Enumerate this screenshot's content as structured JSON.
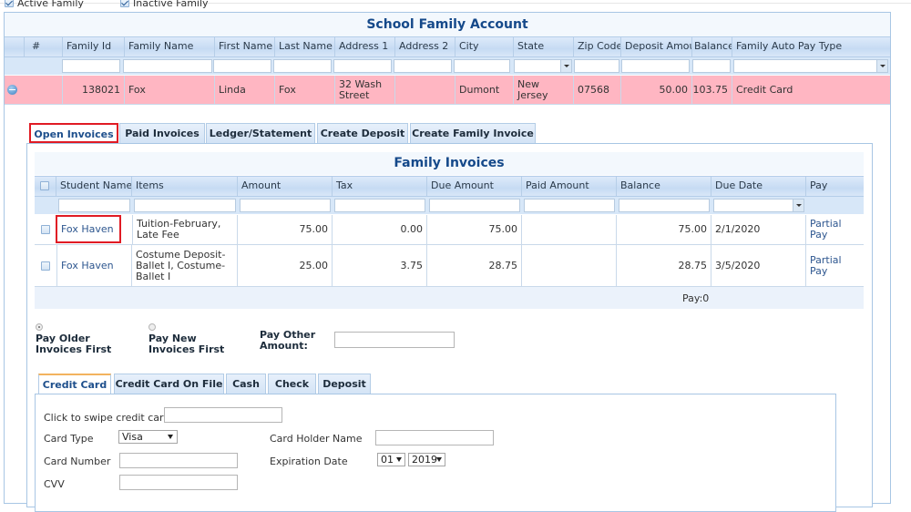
{
  "filters": {
    "active_family": {
      "label": "Active Family",
      "checked": true
    },
    "inactive_family": {
      "label": "Inactive Family",
      "checked": true
    }
  },
  "family_grid": {
    "title": "School Family Account",
    "columns": [
      "#",
      "Family Id",
      "Family Name",
      "First Name",
      "Last Name",
      "Address 1",
      "Address 2",
      "City",
      "State",
      "Zip Code",
      "Deposit Amount",
      "Balance",
      "Family Auto Pay Type"
    ],
    "row": {
      "family_id": "138021",
      "family_name": "Fox",
      "first_name": "Linda",
      "last_name": "Fox",
      "address1": "32 Wash Street",
      "address2": "",
      "city": "Dumont",
      "state": "New Jersey",
      "zip": "07568",
      "deposit_amount": "50.00",
      "balance": "103.75",
      "auto_pay_type": "Credit Card"
    },
    "row_color": "#ffb6c2"
  },
  "detail_tabs": [
    {
      "label": "Open Invoices",
      "active": true
    },
    {
      "label": "Paid Invoices",
      "active": false
    },
    {
      "label": "Ledger/Statement",
      "active": false
    },
    {
      "label": "Create Deposit",
      "active": false
    },
    {
      "label": "Create Family Invoice",
      "active": false
    }
  ],
  "invoices": {
    "title": "Family Invoices",
    "columns": [
      "Student Name",
      "Items",
      "Amount",
      "Tax",
      "Due Amount",
      "Paid Amount",
      "Balance",
      "Due Date",
      "Pay"
    ],
    "rows": [
      {
        "student": "Fox Haven",
        "items": "Tuition-February, Late Fee",
        "amount": "75.00",
        "tax": "0.00",
        "due_amount": "75.00",
        "paid_amount": "",
        "balance": "75.00",
        "due_date": "2/1/2020",
        "pay": "Partial Pay"
      },
      {
        "student": "Fox Haven",
        "items": "Costume Deposit-Ballet I, Costume-Ballet I",
        "amount": "25.00",
        "tax": "3.75",
        "due_amount": "28.75",
        "paid_amount": "",
        "balance": "28.75",
        "due_date": "3/5/2020",
        "pay": "Partial Pay"
      }
    ],
    "footer": "Pay:0"
  },
  "pay_options": {
    "older_first": {
      "label": "Pay Older Invoices First",
      "selected": true
    },
    "newer_first": {
      "label": "Pay New Invoices First",
      "selected": false
    },
    "other_amount_label": "Pay Other Amount:",
    "other_amount_value": ""
  },
  "payment_tabs": [
    {
      "label": "Credit Card",
      "active": true
    },
    {
      "label": "Credit Card On File",
      "active": false
    },
    {
      "label": "Cash",
      "active": false
    },
    {
      "label": "Check",
      "active": false
    },
    {
      "label": "Deposit",
      "active": false
    }
  ],
  "credit_card_form": {
    "swipe_label": "Click to swipe credit card",
    "card_type_label": "Card Type",
    "card_type_value": "Visa",
    "card_holder_label": "Card Holder Name",
    "card_number_label": "Card Number",
    "expiration_label": "Expiration Date",
    "exp_month": "01",
    "exp_year": "2019",
    "cvv_label": "CVV"
  },
  "colors": {
    "title": "#15498a",
    "highlight": "#e01b24",
    "link": "#2d568f"
  }
}
